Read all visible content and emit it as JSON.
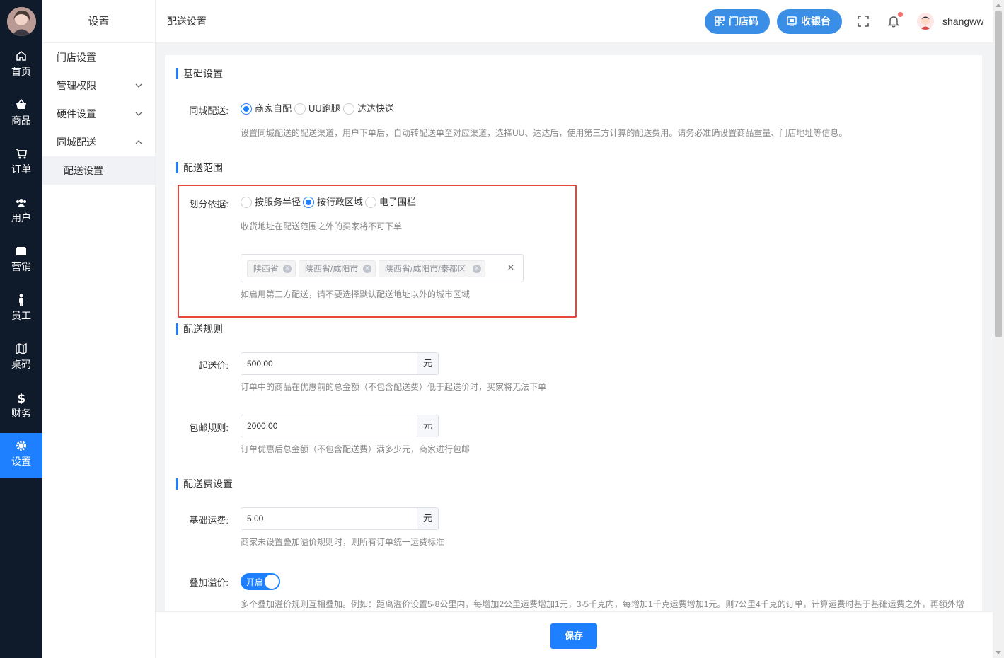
{
  "nav": {
    "items": [
      {
        "label": "首页",
        "icon": "home-icon"
      },
      {
        "label": "商品",
        "icon": "basket-icon"
      },
      {
        "label": "订单",
        "icon": "cart-icon"
      },
      {
        "label": "用户",
        "icon": "users-icon"
      },
      {
        "label": "营销",
        "icon": "wallet-icon"
      },
      {
        "label": "员工",
        "icon": "person-icon"
      },
      {
        "label": "桌码",
        "icon": "map-icon"
      },
      {
        "label": "财务",
        "icon": "dollar-icon"
      },
      {
        "label": "设置",
        "icon": "gear-icon"
      }
    ],
    "active_color": "#1e80ff"
  },
  "sidebar": {
    "title": "设置",
    "items": [
      {
        "label": "门店设置"
      },
      {
        "label": "管理权限"
      },
      {
        "label": "硬件设置"
      },
      {
        "label": "同城配送"
      },
      {
        "label": "配送设置"
      }
    ]
  },
  "header": {
    "breadcrumb": "配送设置",
    "store_code_label": "门店码",
    "cashier_label": "收银台",
    "username": "shangww"
  },
  "basic": {
    "title": "基础设置",
    "label": "同城配送:",
    "options": [
      "商家自配",
      "UU跑腿",
      "达达快送"
    ],
    "selected": "商家自配",
    "hint": "设置同城配送的配送渠道，用户下单后，自动转配送单至对应渠道，选择UU、达达后，使用第三方计算的配送费用。请务必准确设置商品重量、门店地址等信息。"
  },
  "range": {
    "title": "配送范围",
    "label": "划分依据:",
    "options": [
      "按服务半径",
      "按行政区域",
      "电子围栏"
    ],
    "selected": "按行政区域",
    "hint1": "收货地址在配送范围之外的买家将不可下单",
    "tags": [
      "陕西省",
      "陕西省/咸阳市",
      "陕西省/咸阳市/秦都区"
    ],
    "clear": "×",
    "hint2": "如启用第三方配送，请不要选择默认配送地址以外的城市区域"
  },
  "rules": {
    "title": "配送规则",
    "min_label": "起送价:",
    "min_value": "500.00",
    "min_unit": "元",
    "min_hint": "订单中的商品在优惠前的总金额（不包含配送费）低于起送价时，买家将无法下单",
    "free_label": "包邮规则:",
    "free_value": "2000.00",
    "free_unit": "元",
    "free_hint": "订单优惠后总金额（不包含配送费）满多少元，商家进行包邮"
  },
  "fee": {
    "title": "配送费设置",
    "base_label": "基础运费:",
    "base_value": "5.00",
    "base_unit": "元",
    "base_hint": "商家未设置叠加溢价规则时，则所有订单统一运费标准",
    "stack_label": "叠加溢价:",
    "switch_text": "开启",
    "stack_hint": "多个叠加溢价规则互相叠加。例如：距离溢价设置5-8公里内，每增加2公里运费增加1元，3-5千克内，每增加1千克运费增加1元。则7公里4千克的订单，计算运费时基于基础运费之外，再额外增"
  },
  "footer": {
    "save_label": "保存"
  }
}
